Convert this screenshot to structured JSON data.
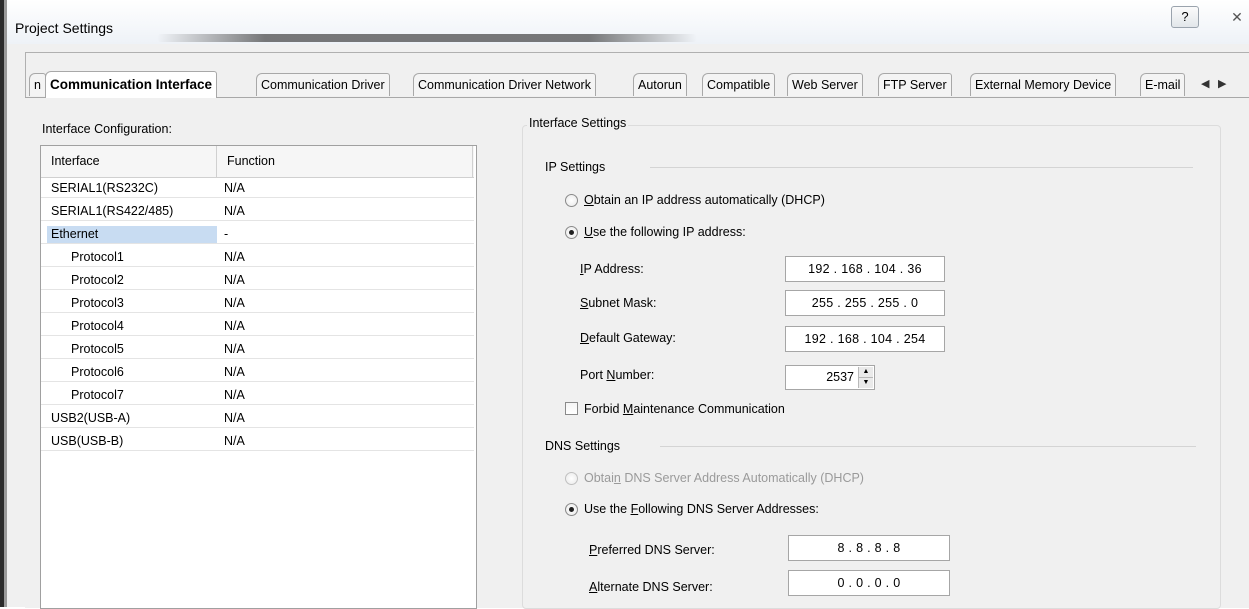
{
  "window": {
    "title": "Project Settings",
    "help_icon": "?",
    "close_icon": "✕"
  },
  "tabs": {
    "items": [
      {
        "label": "n"
      },
      {
        "label": "Communication Interface"
      },
      {
        "label": "Communication Driver"
      },
      {
        "label": "Communication Driver Network"
      },
      {
        "label": "Autorun"
      },
      {
        "label": "Compatible"
      },
      {
        "label": "Web Server"
      },
      {
        "label": "FTP Server"
      },
      {
        "label": "External Memory Device"
      },
      {
        "label": "E-mail"
      }
    ],
    "active_index": 1,
    "scroll_left": "◀",
    "scroll_right": "▶"
  },
  "interface_config": {
    "label": "Interface Configuration:",
    "columns": [
      "Interface",
      "Function"
    ],
    "rows": [
      {
        "interface": "SERIAL1(RS232C)",
        "function": "N/A"
      },
      {
        "interface": "SERIAL1(RS422/485)",
        "function": "N/A"
      },
      {
        "interface": "Ethernet",
        "function": "-"
      },
      {
        "interface": "Protocol1",
        "function": "N/A"
      },
      {
        "interface": "Protocol2",
        "function": "N/A"
      },
      {
        "interface": "Protocol3",
        "function": "N/A"
      },
      {
        "interface": "Protocol4",
        "function": "N/A"
      },
      {
        "interface": "Protocol5",
        "function": "N/A"
      },
      {
        "interface": "Protocol6",
        "function": "N/A"
      },
      {
        "interface": "Protocol7",
        "function": "N/A"
      },
      {
        "interface": "USB2(USB-A)",
        "function": "N/A"
      },
      {
        "interface": "USB(USB-B)",
        "function": "N/A"
      }
    ],
    "selected_row": 2
  },
  "interface_settings": {
    "title": "Interface Settings",
    "ip": {
      "title": "IP Settings",
      "dhcp": {
        "prefix": "",
        "key": "O",
        "rest": "btain an IP address automatically (DHCP)",
        "checked": false
      },
      "manual": {
        "prefix": "",
        "key": "U",
        "rest": "se the following IP address:",
        "checked": true
      },
      "ip_address": {
        "prefix": "",
        "key": "I",
        "rest": "P Address:",
        "value": "192 . 168 . 104 . 36"
      },
      "subnet_mask": {
        "prefix": "",
        "key": "S",
        "rest": "ubnet Mask:",
        "value": "255 . 255 . 255 .  0"
      },
      "gateway": {
        "prefix": "",
        "key": "D",
        "rest": "efault Gateway:",
        "value": "192 . 168 . 104 . 254"
      },
      "port": {
        "prefix": "Port ",
        "key": "N",
        "rest": "umber:",
        "value": "2537"
      },
      "forbid": {
        "prefix": "Forbid ",
        "key": "M",
        "rest": "aintenance Communication",
        "checked": false
      }
    },
    "dns": {
      "title": "DNS Settings",
      "auto": {
        "prefix": "Obtai",
        "key": "n",
        "rest": " DNS Server Address Automatically (DHCP)",
        "checked": false,
        "disabled": true
      },
      "manual": {
        "prefix": "Use the ",
        "key": "F",
        "rest": "ollowing DNS Server Addresses:",
        "checked": true
      },
      "preferred": {
        "prefix": "",
        "key": "P",
        "rest": "referred DNS Server:",
        "value": "8  .  8  .  8  .  8"
      },
      "alternate": {
        "prefix": "",
        "key": "A",
        "rest": "lternate DNS Server:",
        "value": "0  .  0  .  0  .  0"
      }
    }
  }
}
